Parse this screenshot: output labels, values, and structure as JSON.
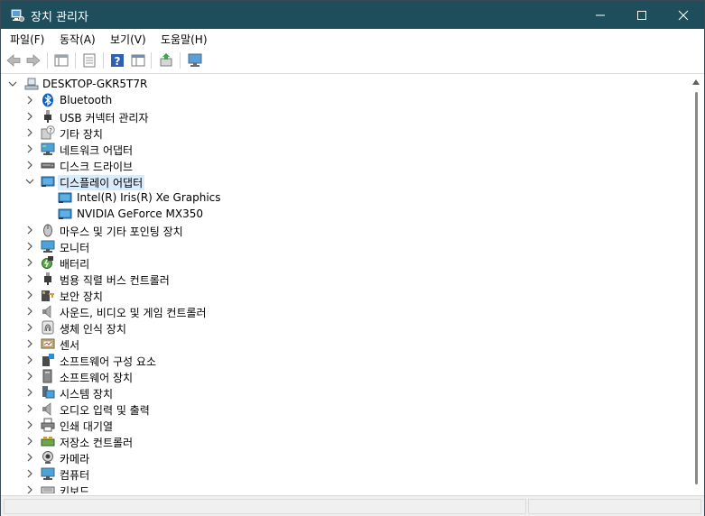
{
  "window": {
    "title": "장치 관리자",
    "controls": {
      "minimize": "minimize-icon",
      "maximize": "maximize-icon",
      "close": "close-icon"
    },
    "titlebar_color": "#1e4e5c"
  },
  "menu": {
    "items": [
      "파일(F)",
      "동작(A)",
      "보기(V)",
      "도움말(H)"
    ]
  },
  "toolbar": {
    "icons": [
      "back-arrow-icon",
      "forward-arrow-icon",
      "properties-pane-icon",
      "properties-page-icon",
      "help-icon",
      "view-pane-icon",
      "update-driver-icon",
      "monitor-scan-icon"
    ]
  },
  "tree": {
    "root": "DESKTOP-GKR5T7R",
    "items": [
      {
        "label": "Bluetooth",
        "icon": "bluetooth-icon"
      },
      {
        "label": "USB 커넥터 관리자",
        "icon": "usb-icon"
      },
      {
        "label": "기타 장치",
        "icon": "unknown-device-icon"
      },
      {
        "label": "네트워크 어댑터",
        "icon": "network-adapter-icon"
      },
      {
        "label": "디스크 드라이브",
        "icon": "disk-drive-icon"
      },
      {
        "label": "디스플레이 어댑터",
        "icon": "display-adapter-icon",
        "expanded": true,
        "selected": true,
        "children": [
          {
            "label": "Intel(R) Iris(R) Xe Graphics",
            "icon": "display-adapter-icon"
          },
          {
            "label": "NVIDIA GeForce MX350",
            "icon": "display-adapter-icon"
          }
        ]
      },
      {
        "label": "마우스 및 기타 포인팅 장치",
        "icon": "mouse-icon"
      },
      {
        "label": "모니터",
        "icon": "monitor-icon"
      },
      {
        "label": "배터리",
        "icon": "battery-icon"
      },
      {
        "label": "범용 직렬 버스 컨트롤러",
        "icon": "usb-controller-icon"
      },
      {
        "label": "보안 장치",
        "icon": "security-device-icon"
      },
      {
        "label": "사운드, 비디오 및 게임 컨트롤러",
        "icon": "speaker-icon"
      },
      {
        "label": "생체 인식 장치",
        "icon": "fingerprint-icon"
      },
      {
        "label": "센서",
        "icon": "sensor-icon"
      },
      {
        "label": "소프트웨어 구성 요소",
        "icon": "software-component-icon"
      },
      {
        "label": "소프트웨어 장치",
        "icon": "software-device-icon"
      },
      {
        "label": "시스템 장치",
        "icon": "system-device-icon"
      },
      {
        "label": "오디오 입력 및 출력",
        "icon": "speaker-icon"
      },
      {
        "label": "인쇄 대기열",
        "icon": "printer-icon"
      },
      {
        "label": "저장소 컨트롤러",
        "icon": "storage-controller-icon"
      },
      {
        "label": "카메라",
        "icon": "camera-icon"
      },
      {
        "label": "컴퓨터",
        "icon": "computer-icon"
      },
      {
        "label": "키보드",
        "icon": "keyboard-icon"
      }
    ]
  }
}
